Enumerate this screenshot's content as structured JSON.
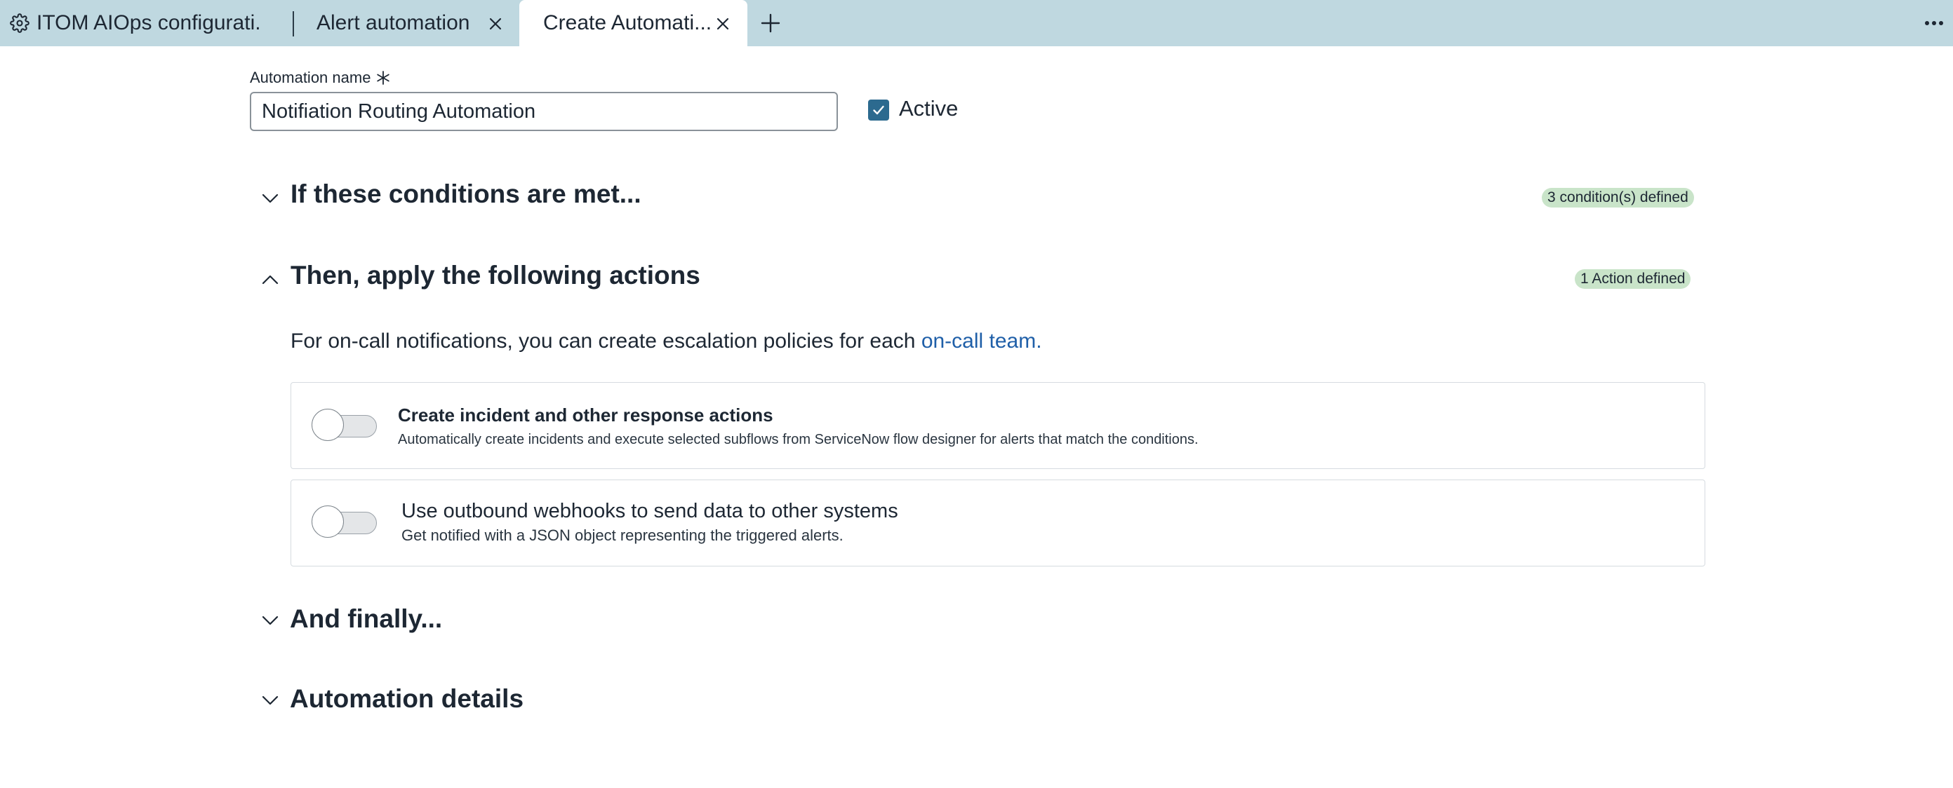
{
  "tabs": [
    {
      "label": "ITOM AIOps configurati...",
      "icon": "gear-icon"
    },
    {
      "label": "Alert automation",
      "close_icon": "close-icon"
    },
    {
      "label": "Create Automati...",
      "close_icon": "close-icon",
      "active": true
    }
  ],
  "tabbar": {
    "add_icon": "plus-icon",
    "more_icon": "more-horizontal-icon"
  },
  "form": {
    "name_label": "Automation name",
    "required_icon": "required-asterisk-icon",
    "name_value": "Notifiation Routing Automation",
    "active_label": "Active",
    "active_checked": true
  },
  "sections": {
    "conditions": {
      "title": "If these conditions are met...",
      "badge": "3 condition(s) defined",
      "expanded": false
    },
    "actions": {
      "title": "Then, apply the following actions",
      "badge": "1 Action defined",
      "expanded": true
    },
    "finally": {
      "title": "And finally...",
      "expanded": false
    },
    "details": {
      "title": "Automation details",
      "expanded": false
    }
  },
  "actions_info": {
    "text": "For on-call notifications, you can create escalation policies for each",
    "link": "on-call team."
  },
  "action_cards": [
    {
      "title": "Create incident and other response actions",
      "description": "Automatically create incidents and execute selected subflows from ServiceNow flow designer for alerts that match the conditions.",
      "enabled": false
    },
    {
      "title": "Use outbound webhooks to send data to other systems",
      "description": "Get notified with a JSON object representing the triggered alerts.",
      "enabled": false
    }
  ],
  "colors": {
    "tabbar_bg": "#bfd8e0",
    "checkbox": "#2c6a8f",
    "badge_bg": "#c9e4c9",
    "link": "#1f5fa8"
  }
}
